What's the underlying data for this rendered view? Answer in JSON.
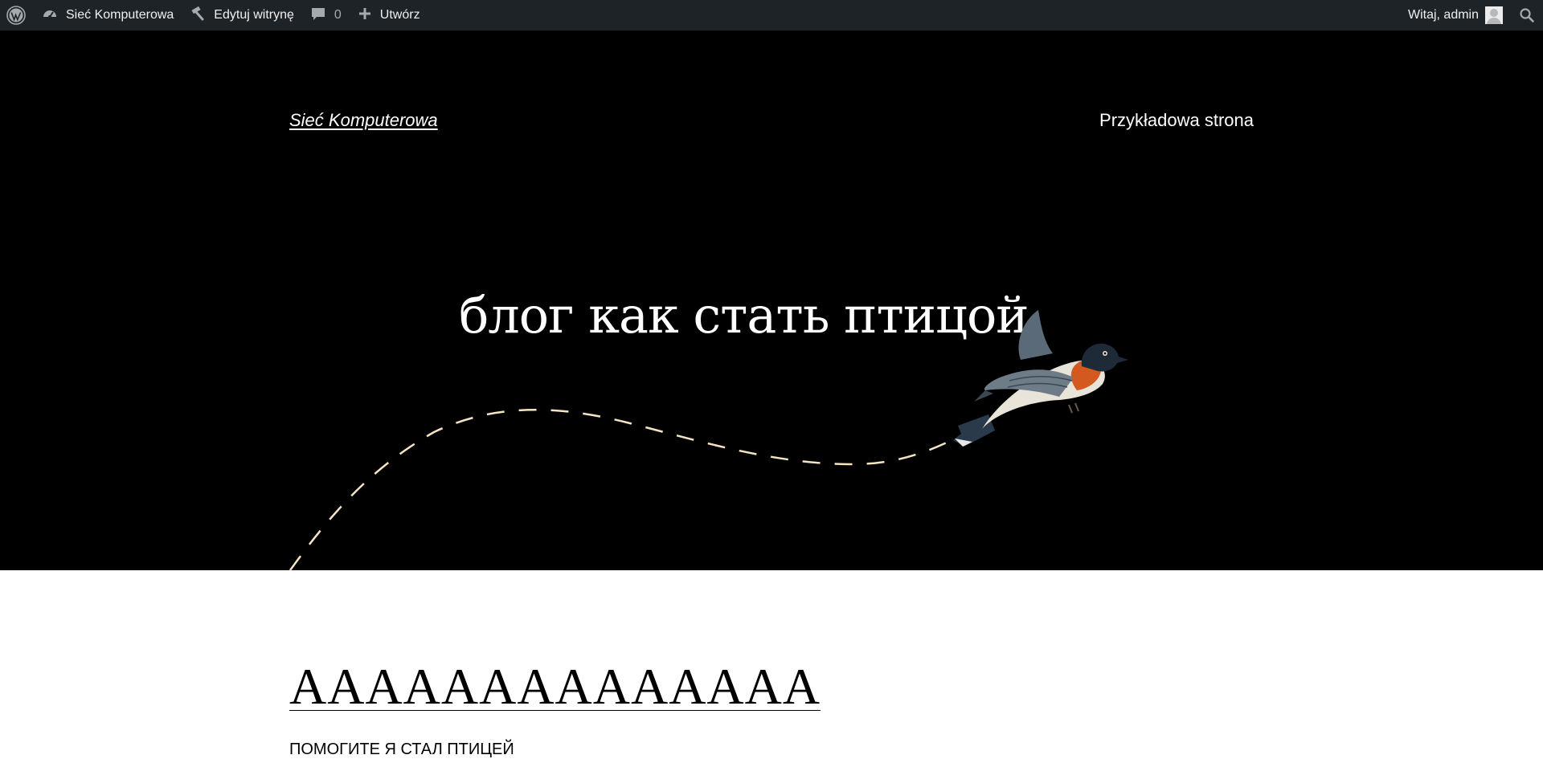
{
  "admin_bar": {
    "wp_logo_icon": "wordpress-logo-icon",
    "site_name": "Sieć Komputerowa",
    "site_icon": "dashboard-icon",
    "edit_site": "Edytuj witrynę",
    "edit_icon": "hammer-icon",
    "comments_count": "0",
    "comments_icon": "comment-bubble-icon",
    "new_label": "Utwórz",
    "new_icon": "plus-icon",
    "greeting": "Witaj, admin",
    "search_icon": "search-icon"
  },
  "header": {
    "site_title": "Sieć Komputerowa",
    "nav": [
      "Przykładowa strona"
    ]
  },
  "hero": {
    "heading": "блог как стать птицой",
    "illustration": "flying-bird-with-dashed-trail"
  },
  "post": {
    "title": "АААААААААААААA",
    "excerpt": "ПОМОГИТЕ Я СТАЛ ПТИЦЕЙ"
  },
  "colors": {
    "admin_bar_bg": "#1d2327",
    "hero_bg": "#000000",
    "trail": "#f3e5c3"
  }
}
